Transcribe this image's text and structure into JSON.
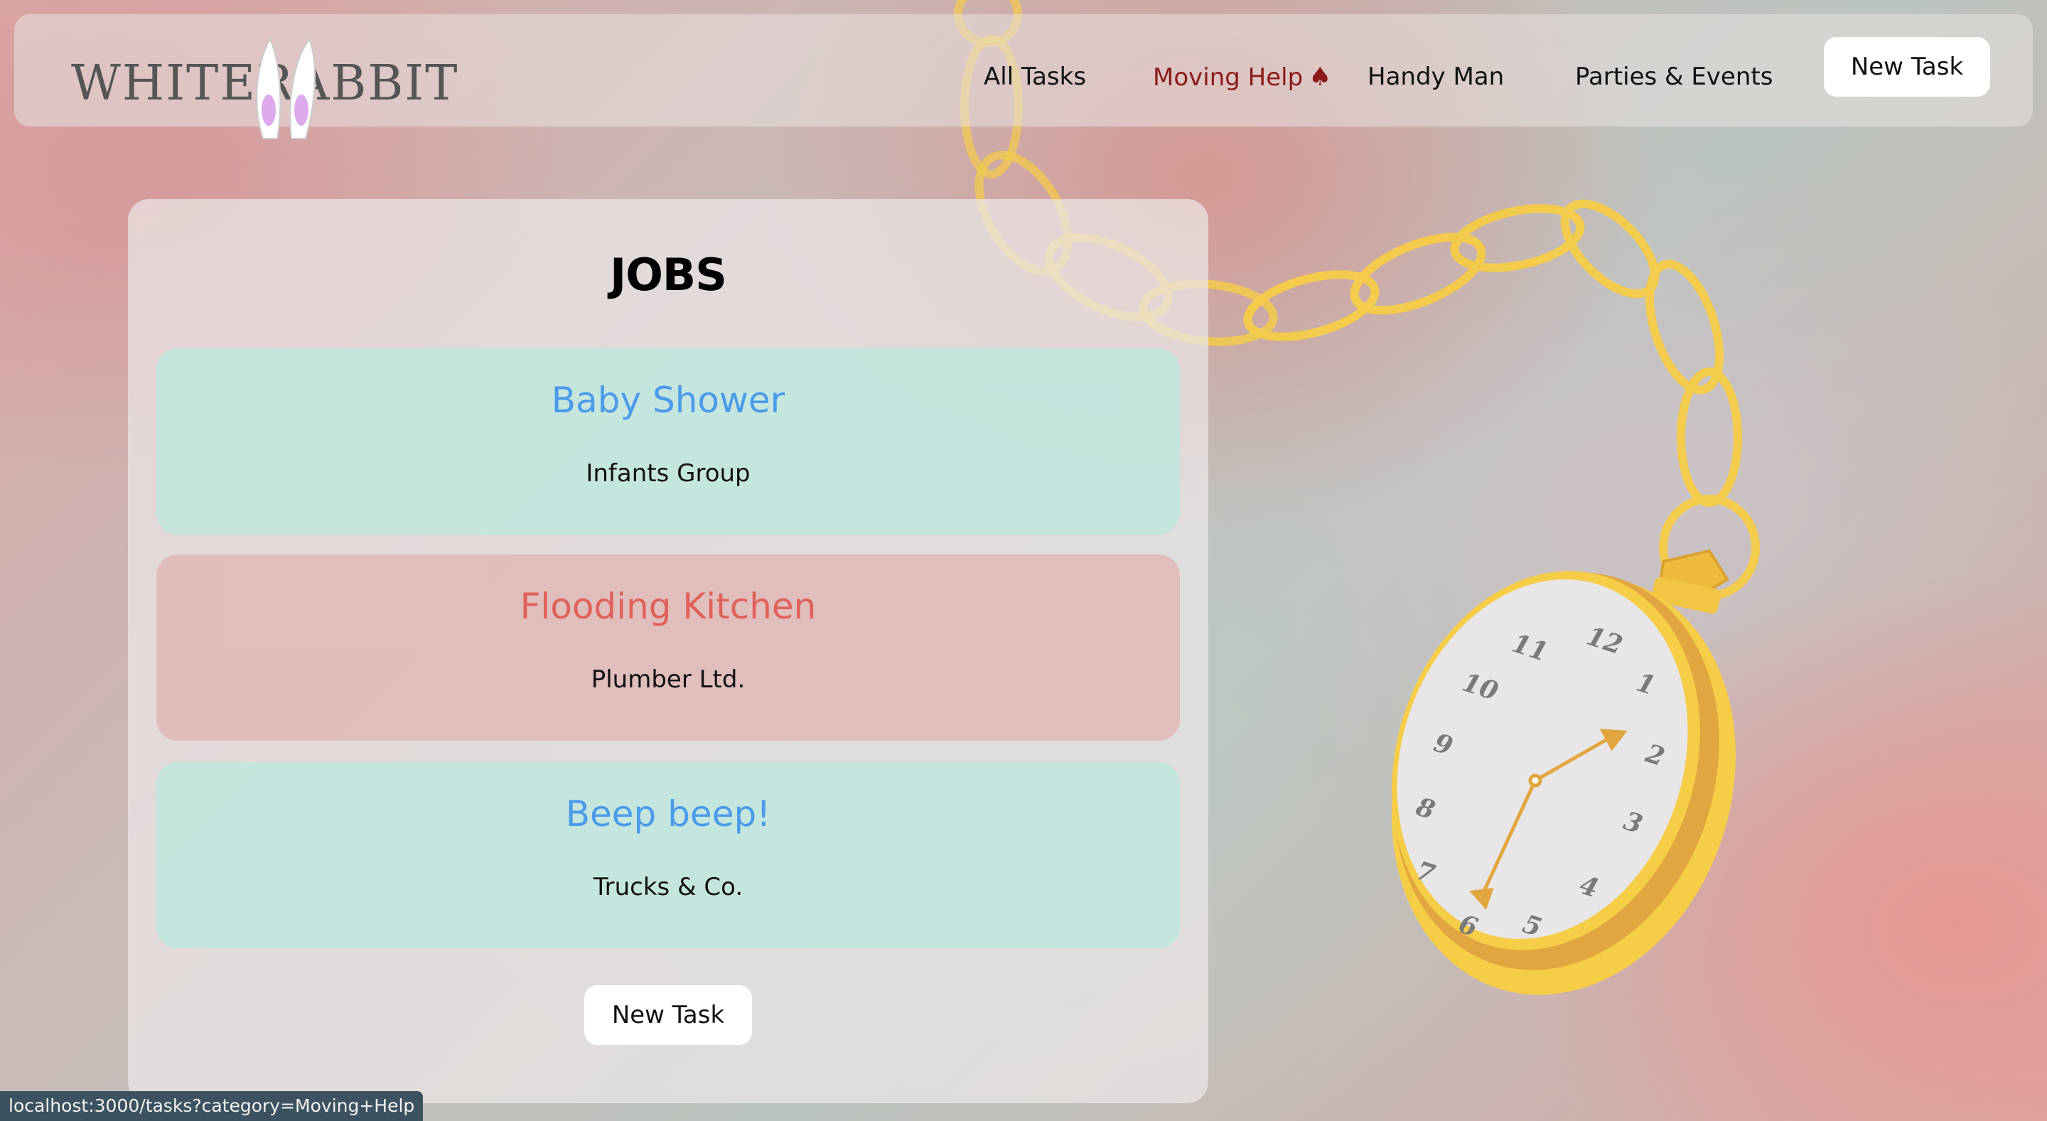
{
  "app": {
    "logo_text": "WHITERABBIT"
  },
  "nav": {
    "links": [
      {
        "label": "All Tasks"
      },
      {
        "label": "Moving Help",
        "icon": "spade-icon",
        "active": true
      },
      {
        "label": "Handy Man"
      },
      {
        "label": "Parties & Events"
      }
    ],
    "new_task_label": "New Task"
  },
  "jobs": {
    "title": "JOBS",
    "items": [
      {
        "name": "Baby Shower",
        "company": "Infants Group",
        "color": "#4a9bea"
      },
      {
        "name": "Flooding Kitchen",
        "company": "Plumber Ltd.",
        "color": "#e0605a"
      },
      {
        "name": "Beep beep!",
        "company": "Trucks & Co.",
        "color": "#4a9bea"
      }
    ],
    "new_task_label": "New Task"
  },
  "watch": {
    "numerals": [
      "12",
      "1",
      "2",
      "3",
      "4",
      "5",
      "6",
      "7",
      "8",
      "9",
      "10",
      "11"
    ]
  },
  "status_bar": {
    "url": "localhost:3000/tasks?category=Moving+Help"
  },
  "colors": {
    "accent_active": "#8b1a1a",
    "gold": "#f5cc45",
    "teal_card": "#bee8de",
    "red_card": "#e1b9b6"
  }
}
